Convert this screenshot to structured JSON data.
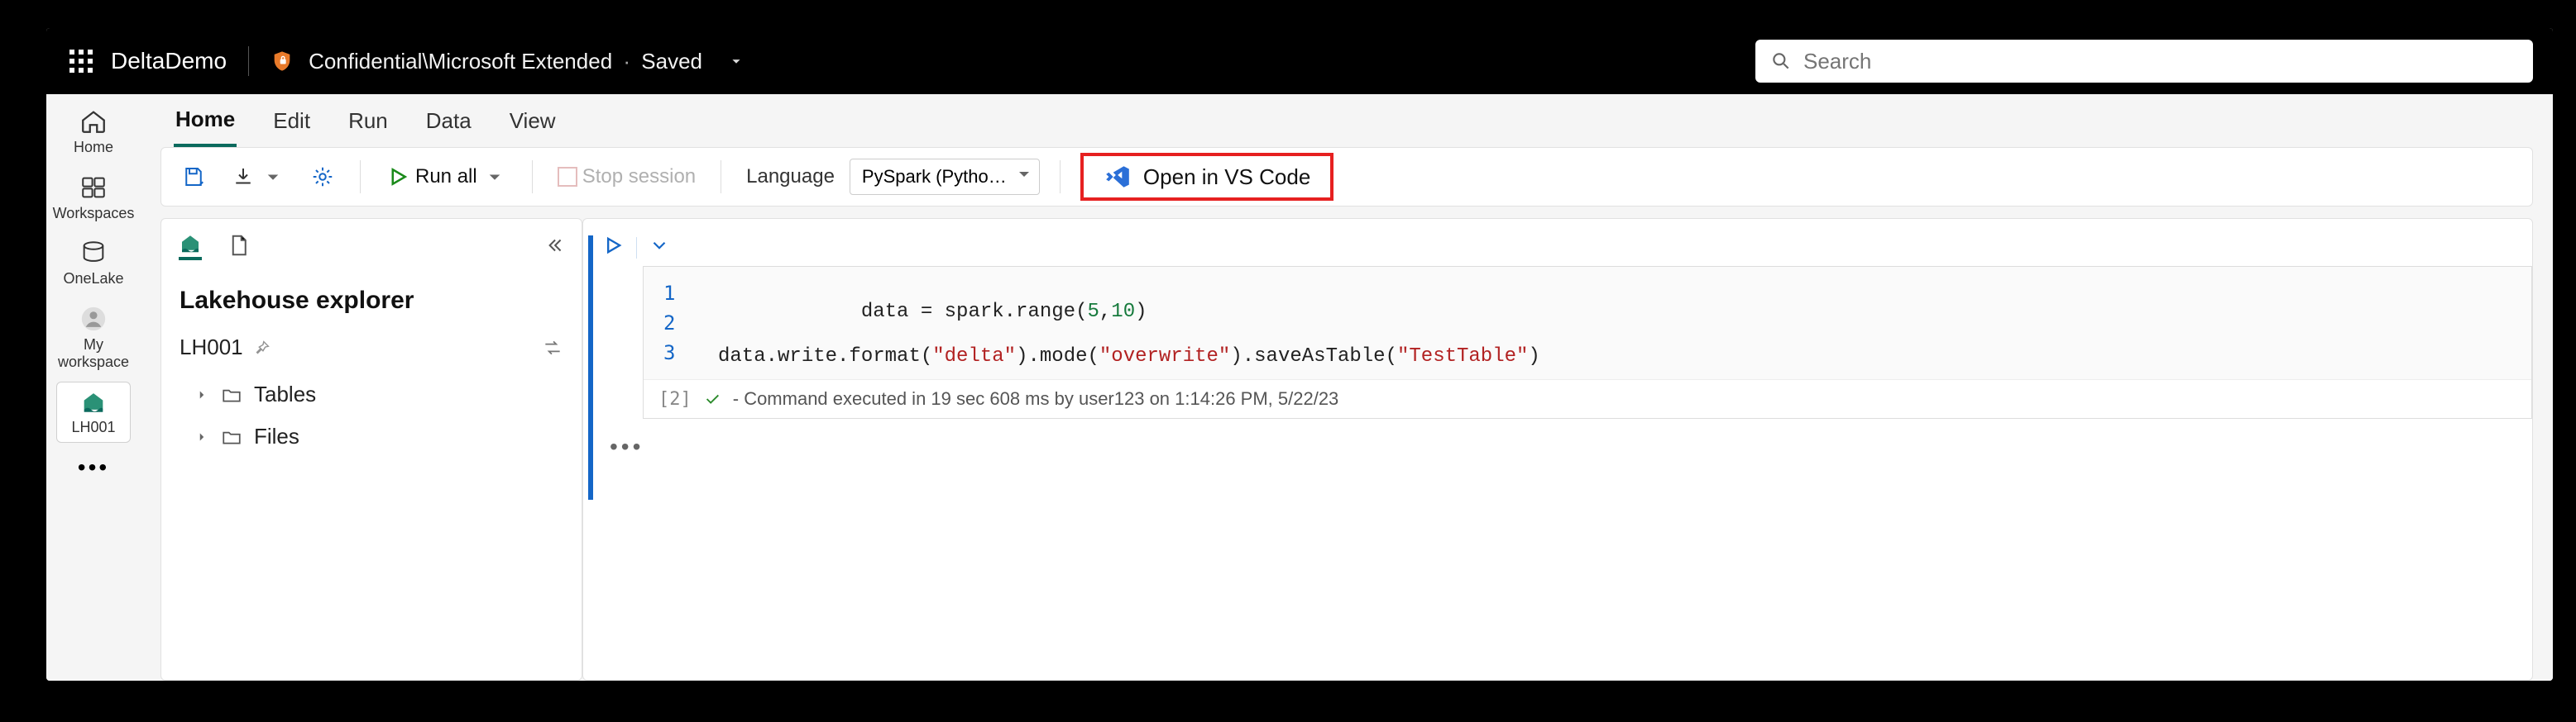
{
  "topbar": {
    "brand": "DeltaDemo",
    "confidential": "Confidential\\Microsoft Extended",
    "dot": "·",
    "saved": "Saved",
    "search_placeholder": "Search"
  },
  "rail": {
    "home": "Home",
    "workspaces": "Workspaces",
    "onelake": "OneLake",
    "my_workspace_l1": "My",
    "my_workspace_l2": "workspace",
    "active": "LH001"
  },
  "tabs": {
    "home": "Home",
    "edit": "Edit",
    "run": "Run",
    "data": "Data",
    "view": "View"
  },
  "toolbar": {
    "run_all": "Run all",
    "stop": "Stop session",
    "language_label": "Language",
    "language_value": "PySpark (Pytho…",
    "open_vscode": "Open in VS Code"
  },
  "explorer": {
    "title": "Lakehouse explorer",
    "item_name": "LH001",
    "tables": "Tables",
    "files": "Files"
  },
  "notebook": {
    "exec_count": "[2]",
    "status": "- Command executed in 19 sec 608 ms by user123 on 1:14:26 PM, 5/22/23",
    "line_numbers": "1\n2\n3",
    "code_l1_a": "data = spark.range(",
    "code_l1_n1": "5",
    "code_l1_c": ",",
    "code_l1_n2": "10",
    "code_l1_b": ")",
    "code_l3_a": "data.write.format(",
    "code_l3_s1": "\"delta\"",
    "code_l3_b": ").mode(",
    "code_l3_s2": "\"overwrite\"",
    "code_l3_c": ").saveAsTable(",
    "code_l3_s3": "\"TestTable\"",
    "code_l3_d": ")"
  }
}
